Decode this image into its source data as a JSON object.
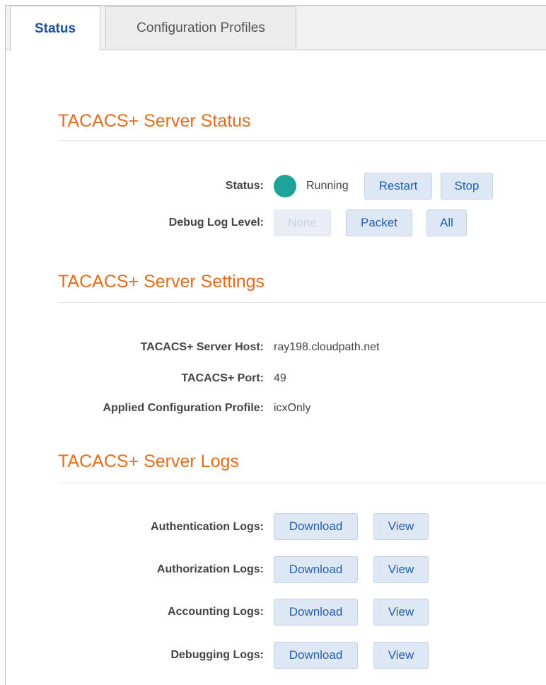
{
  "tabs": [
    {
      "label": "Status",
      "active": true
    },
    {
      "label": "Configuration Profiles",
      "active": false
    }
  ],
  "status_section": {
    "title": "TACACS+ Server Status",
    "status_label": "Status:",
    "status_value": "Running",
    "status_color": "#1ea39a",
    "restart_label": "Restart",
    "stop_label": "Stop",
    "debug_label": "Debug Log Level:",
    "debug_options": [
      {
        "label": "None",
        "enabled": false
      },
      {
        "label": "Packet",
        "enabled": true
      },
      {
        "label": "All",
        "enabled": true
      }
    ]
  },
  "settings_section": {
    "title": "TACACS+ Server Settings",
    "rows": [
      {
        "label": "TACACS+ Server Host:",
        "value": "ray198.cloudpath.net"
      },
      {
        "label": "TACACS+ Port:",
        "value": "49"
      },
      {
        "label": "Applied Configuration Profile:",
        "value": "icxOnly"
      }
    ]
  },
  "logs_section": {
    "title": "TACACS+ Server Logs",
    "download_label": "Download",
    "view_label": "View",
    "rows": [
      {
        "label": "Authentication Logs:"
      },
      {
        "label": "Authorization Logs:"
      },
      {
        "label": "Accounting Logs:"
      },
      {
        "label": "Debugging Logs:"
      }
    ]
  },
  "colors": {
    "accent_title": "#e46c1a",
    "active_tab": "#1b4f9c",
    "button_bg": "#dde8f4",
    "button_text": "#245ea8"
  }
}
